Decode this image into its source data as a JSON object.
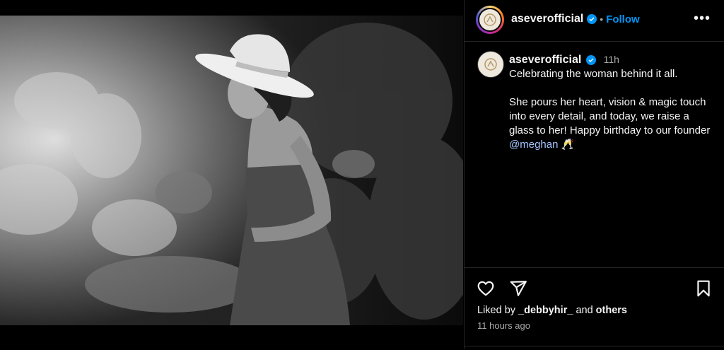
{
  "post": {
    "account": "aseverofficial",
    "follow_label": "Follow",
    "dot": "•",
    "more_label": "•••",
    "time_short": "11h",
    "caption_line1": "Celebrating the woman behind it all.",
    "caption_body": "She pours her heart, vision & magic touch into every detail, and today, we raise a glass to her! Happy birthday to our founder",
    "mention": "@meghan",
    "emoji": "🥂",
    "liked_prefix": "Liked by",
    "liked_user": "_debbyhir_",
    "liked_and": "and",
    "liked_others": "others",
    "time_ago": "11 hours ago"
  },
  "icons": {
    "like": "heart-icon",
    "share": "share-icon",
    "save": "bookmark-icon",
    "verified": "verified-badge-icon",
    "more": "more-options-icon"
  },
  "colors": {
    "background": "#000000",
    "link": "#0095f6",
    "verified": "#0095f6",
    "muted": "#a8a8a8",
    "divider": "#262626"
  }
}
